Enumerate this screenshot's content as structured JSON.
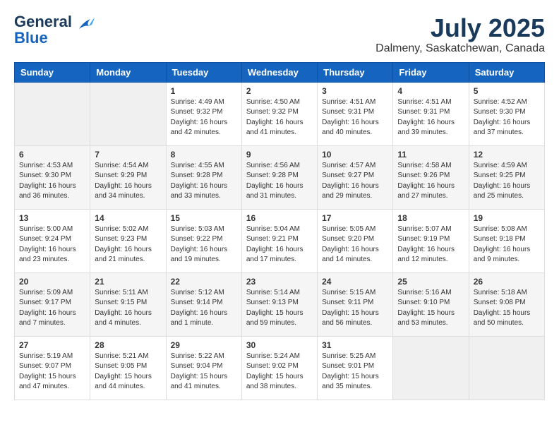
{
  "header": {
    "logo_line1": "General",
    "logo_line2": "Blue",
    "title": "July 2025",
    "subtitle": "Dalmeny, Saskatchewan, Canada"
  },
  "calendar": {
    "headers": [
      "Sunday",
      "Monday",
      "Tuesday",
      "Wednesday",
      "Thursday",
      "Friday",
      "Saturday"
    ],
    "weeks": [
      [
        {
          "day": "",
          "info": ""
        },
        {
          "day": "",
          "info": ""
        },
        {
          "day": "1",
          "info": "Sunrise: 4:49 AM\nSunset: 9:32 PM\nDaylight: 16 hours\nand 42 minutes."
        },
        {
          "day": "2",
          "info": "Sunrise: 4:50 AM\nSunset: 9:32 PM\nDaylight: 16 hours\nand 41 minutes."
        },
        {
          "day": "3",
          "info": "Sunrise: 4:51 AM\nSunset: 9:31 PM\nDaylight: 16 hours\nand 40 minutes."
        },
        {
          "day": "4",
          "info": "Sunrise: 4:51 AM\nSunset: 9:31 PM\nDaylight: 16 hours\nand 39 minutes."
        },
        {
          "day": "5",
          "info": "Sunrise: 4:52 AM\nSunset: 9:30 PM\nDaylight: 16 hours\nand 37 minutes."
        }
      ],
      [
        {
          "day": "6",
          "info": "Sunrise: 4:53 AM\nSunset: 9:30 PM\nDaylight: 16 hours\nand 36 minutes."
        },
        {
          "day": "7",
          "info": "Sunrise: 4:54 AM\nSunset: 9:29 PM\nDaylight: 16 hours\nand 34 minutes."
        },
        {
          "day": "8",
          "info": "Sunrise: 4:55 AM\nSunset: 9:28 PM\nDaylight: 16 hours\nand 33 minutes."
        },
        {
          "day": "9",
          "info": "Sunrise: 4:56 AM\nSunset: 9:28 PM\nDaylight: 16 hours\nand 31 minutes."
        },
        {
          "day": "10",
          "info": "Sunrise: 4:57 AM\nSunset: 9:27 PM\nDaylight: 16 hours\nand 29 minutes."
        },
        {
          "day": "11",
          "info": "Sunrise: 4:58 AM\nSunset: 9:26 PM\nDaylight: 16 hours\nand 27 minutes."
        },
        {
          "day": "12",
          "info": "Sunrise: 4:59 AM\nSunset: 9:25 PM\nDaylight: 16 hours\nand 25 minutes."
        }
      ],
      [
        {
          "day": "13",
          "info": "Sunrise: 5:00 AM\nSunset: 9:24 PM\nDaylight: 16 hours\nand 23 minutes."
        },
        {
          "day": "14",
          "info": "Sunrise: 5:02 AM\nSunset: 9:23 PM\nDaylight: 16 hours\nand 21 minutes."
        },
        {
          "day": "15",
          "info": "Sunrise: 5:03 AM\nSunset: 9:22 PM\nDaylight: 16 hours\nand 19 minutes."
        },
        {
          "day": "16",
          "info": "Sunrise: 5:04 AM\nSunset: 9:21 PM\nDaylight: 16 hours\nand 17 minutes."
        },
        {
          "day": "17",
          "info": "Sunrise: 5:05 AM\nSunset: 9:20 PM\nDaylight: 16 hours\nand 14 minutes."
        },
        {
          "day": "18",
          "info": "Sunrise: 5:07 AM\nSunset: 9:19 PM\nDaylight: 16 hours\nand 12 minutes."
        },
        {
          "day": "19",
          "info": "Sunrise: 5:08 AM\nSunset: 9:18 PM\nDaylight: 16 hours\nand 9 minutes."
        }
      ],
      [
        {
          "day": "20",
          "info": "Sunrise: 5:09 AM\nSunset: 9:17 PM\nDaylight: 16 hours\nand 7 minutes."
        },
        {
          "day": "21",
          "info": "Sunrise: 5:11 AM\nSunset: 9:15 PM\nDaylight: 16 hours\nand 4 minutes."
        },
        {
          "day": "22",
          "info": "Sunrise: 5:12 AM\nSunset: 9:14 PM\nDaylight: 16 hours\nand 1 minute."
        },
        {
          "day": "23",
          "info": "Sunrise: 5:14 AM\nSunset: 9:13 PM\nDaylight: 15 hours\nand 59 minutes."
        },
        {
          "day": "24",
          "info": "Sunrise: 5:15 AM\nSunset: 9:11 PM\nDaylight: 15 hours\nand 56 minutes."
        },
        {
          "day": "25",
          "info": "Sunrise: 5:16 AM\nSunset: 9:10 PM\nDaylight: 15 hours\nand 53 minutes."
        },
        {
          "day": "26",
          "info": "Sunrise: 5:18 AM\nSunset: 9:08 PM\nDaylight: 15 hours\nand 50 minutes."
        }
      ],
      [
        {
          "day": "27",
          "info": "Sunrise: 5:19 AM\nSunset: 9:07 PM\nDaylight: 15 hours\nand 47 minutes."
        },
        {
          "day": "28",
          "info": "Sunrise: 5:21 AM\nSunset: 9:05 PM\nDaylight: 15 hours\nand 44 minutes."
        },
        {
          "day": "29",
          "info": "Sunrise: 5:22 AM\nSunset: 9:04 PM\nDaylight: 15 hours\nand 41 minutes."
        },
        {
          "day": "30",
          "info": "Sunrise: 5:24 AM\nSunset: 9:02 PM\nDaylight: 15 hours\nand 38 minutes."
        },
        {
          "day": "31",
          "info": "Sunrise: 5:25 AM\nSunset: 9:01 PM\nDaylight: 15 hours\nand 35 minutes."
        },
        {
          "day": "",
          "info": ""
        },
        {
          "day": "",
          "info": ""
        }
      ]
    ]
  }
}
